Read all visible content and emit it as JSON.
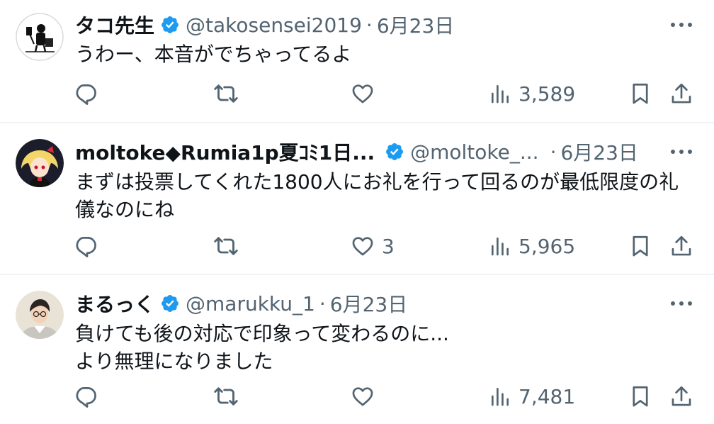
{
  "tweets": [
    {
      "name": "タコ先生",
      "handle": "@takosensei2019",
      "separator": "·",
      "date": "6月23日",
      "text": "うわー、本音がでちゃってるよ",
      "likes": "",
      "views": "3,589"
    },
    {
      "name": "moltoke◆Rumia1p夏ｺﾐ1日...",
      "handle": "@moltoke_...",
      "separator": "·",
      "date": "6月23日",
      "text": "まずは投票してくれた1800人にお礼を行って回るのが最低限度の礼\n儀なのにね",
      "likes": "3",
      "views": "5,965"
    },
    {
      "name": "まるっく",
      "handle": "@marukku_1",
      "separator": "·",
      "date": "6月23日",
      "text": "負けても後の対応で印象って変わるのに...\nより無理になりました",
      "likes": "",
      "views": "7,481"
    }
  ],
  "colors": {
    "verified": "#1d9bf0",
    "muted": "#536471",
    "divider": "#eff3f4"
  },
  "icons": [
    "reply-icon",
    "retweet-icon",
    "like-icon",
    "views-icon",
    "bookmark-icon",
    "share-icon",
    "more-icon",
    "verified-badge-icon"
  ]
}
